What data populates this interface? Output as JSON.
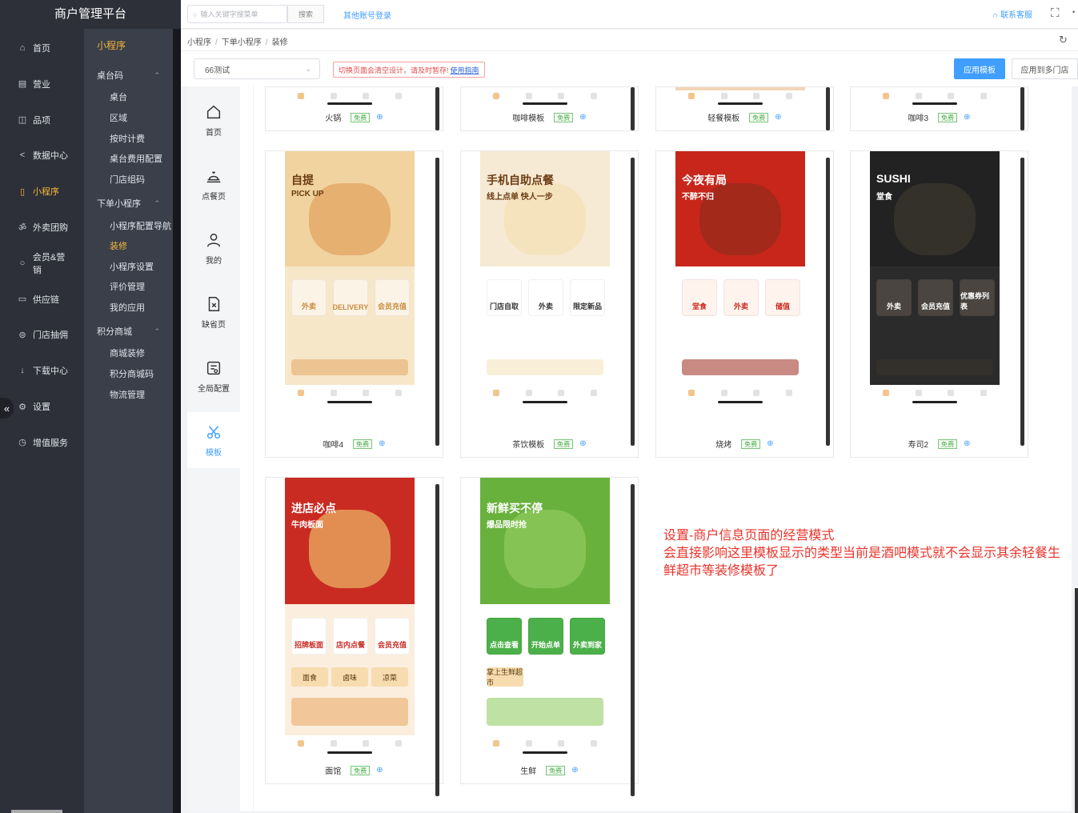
{
  "app": {
    "title": "商户管理平台"
  },
  "topbar": {
    "search_placeholder": "输入关键字搜菜单",
    "search_button": "搜索",
    "other_login": "其他账号登录",
    "service": "联系客服"
  },
  "nav": {
    "primary": [
      {
        "label": "首页",
        "icon": "home-icon"
      },
      {
        "label": "营业",
        "icon": "calendar-icon"
      },
      {
        "label": "品项",
        "icon": "bag-icon"
      },
      {
        "label": "数据中心",
        "icon": "share-icon"
      },
      {
        "label": "小程序",
        "icon": "phone-icon",
        "active": true
      },
      {
        "label": "外卖团购",
        "icon": "bike-icon"
      },
      {
        "label": "会员&营销",
        "icon": "user-icon"
      },
      {
        "label": "供应链",
        "icon": "truck-icon"
      },
      {
        "label": "门店抽佣",
        "icon": "coins-icon"
      },
      {
        "label": "下载中心",
        "icon": "download-icon"
      },
      {
        "label": "设置",
        "icon": "gear-icon"
      },
      {
        "label": "增值服务",
        "icon": "clock-icon"
      }
    ],
    "secondary_title": "小程序",
    "secondary": [
      {
        "label": "桌台码",
        "type": "group"
      },
      {
        "label": "桌台",
        "type": "item"
      },
      {
        "label": "区域",
        "type": "item"
      },
      {
        "label": "按时计费",
        "type": "item"
      },
      {
        "label": "桌台费用配置",
        "type": "item"
      },
      {
        "label": "门店组码",
        "type": "item"
      },
      {
        "label": "下单小程序",
        "type": "group"
      },
      {
        "label": "小程序配置导航",
        "type": "item"
      },
      {
        "label": "装修",
        "type": "item",
        "active": true
      },
      {
        "label": "小程序设置",
        "type": "item"
      },
      {
        "label": "评价管理",
        "type": "item"
      },
      {
        "label": "我的应用",
        "type": "item"
      },
      {
        "label": "积分商城",
        "type": "group"
      },
      {
        "label": "商城装修",
        "type": "item"
      },
      {
        "label": "积分商城码",
        "type": "item"
      },
      {
        "label": "物流管理",
        "type": "item"
      }
    ]
  },
  "breadcrumb": [
    "小程序",
    "下单小程序",
    "装修"
  ],
  "toolbar": {
    "store": "66测试",
    "warning": "切换页面会清空设计，请及时暂存!",
    "guide": "使用指南",
    "apply": "应用模板",
    "apply_multi": "应用到多门店"
  },
  "page_nav": [
    {
      "label": "首页",
      "icon": "home-icon"
    },
    {
      "label": "点餐页",
      "icon": "cloche-icon"
    },
    {
      "label": "我的",
      "icon": "user-icon"
    },
    {
      "label": "缺省页",
      "icon": "doc-x-icon"
    },
    {
      "label": "全局配置",
      "icon": "settings-doc-icon"
    },
    {
      "label": "模板",
      "icon": "scissors-icon",
      "active": true
    }
  ],
  "templates": [
    {
      "name": "火锅",
      "badge": "免费"
    },
    {
      "name": "咖啡模板",
      "badge": "免费"
    },
    {
      "name": "轻餐模板",
      "badge": "免费"
    },
    {
      "name": "咖啡3",
      "badge": "免费"
    },
    {
      "name": "咖啡4",
      "badge": "免费",
      "texts": [
        "自提",
        "PICK UP",
        "外卖",
        "DELIVERY",
        "会员充值"
      ]
    },
    {
      "name": "茶饮模板",
      "badge": "免费",
      "texts": [
        "手机自助点餐",
        "线上点单 快人一步",
        "门店自取",
        "外卖",
        "限定新品"
      ]
    },
    {
      "name": "烧烤",
      "badge": "免费",
      "texts": [
        "今夜有局",
        "不醉不归",
        "堂食",
        "外卖",
        "储值"
      ]
    },
    {
      "name": "寿司2",
      "badge": "免费",
      "texts": [
        "SUSHI",
        "堂食",
        "外卖",
        "会员充值",
        "优惠券列表"
      ]
    },
    {
      "name": "面馆",
      "badge": "免费",
      "texts": [
        "进店必点",
        "牛肉板面",
        "招牌板面",
        "店内点餐",
        "会员充值",
        "面食",
        "卤味",
        "凉菜"
      ]
    },
    {
      "name": "生鲜",
      "badge": "免费",
      "texts": [
        "新鲜买不停",
        "爆品限时抢",
        "点击查看",
        "开始点单",
        "外卖到家",
        "掌上生鲜超市"
      ]
    }
  ],
  "note": "设置-商户信息页面的经营模式\n会直接影响这里模板显示的类型当前是酒吧模式就不会显示其余轻餐生鲜超市等装修模板了",
  "colors": {
    "accent": "#409eff",
    "nav_active": "#f5b73c",
    "note": "#e8332b"
  }
}
